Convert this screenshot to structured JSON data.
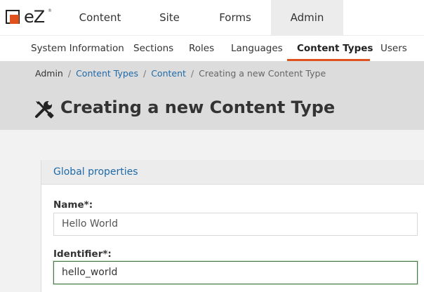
{
  "app": {
    "logo_text": "eZ",
    "logo_tm": "®"
  },
  "main_nav": {
    "tabs": [
      {
        "label": "Content",
        "active": false
      },
      {
        "label": "Site",
        "active": false
      },
      {
        "label": "Forms",
        "active": false
      },
      {
        "label": "Admin",
        "active": true
      }
    ]
  },
  "sub_nav": {
    "items": [
      {
        "label": "System Information",
        "active": false
      },
      {
        "label": "Sections",
        "active": false
      },
      {
        "label": "Roles",
        "active": false
      },
      {
        "label": "Languages",
        "active": false
      },
      {
        "label": "Content Types",
        "active": true
      },
      {
        "label": "Users",
        "active": false
      }
    ],
    "accent_color": "#e0521d"
  },
  "breadcrumb": {
    "items": [
      {
        "label": "Admin",
        "link": false
      },
      {
        "label": "Content Types",
        "link": true
      },
      {
        "label": "Content",
        "link": true
      },
      {
        "label": "Creating a new Content Type",
        "link": false
      }
    ]
  },
  "page": {
    "title": "Creating a new Content Type",
    "title_icon": "tools-icon"
  },
  "form": {
    "section_title": "Global properties",
    "fields": [
      {
        "label": "Name*:",
        "value": "Hello World",
        "focused": false
      },
      {
        "label": "Identifier*:",
        "value": "hello_world",
        "focused": true
      }
    ]
  },
  "colors": {
    "link": "#1e6aa8",
    "accent": "#e0521d",
    "header_bg": "#dcdcdc"
  }
}
